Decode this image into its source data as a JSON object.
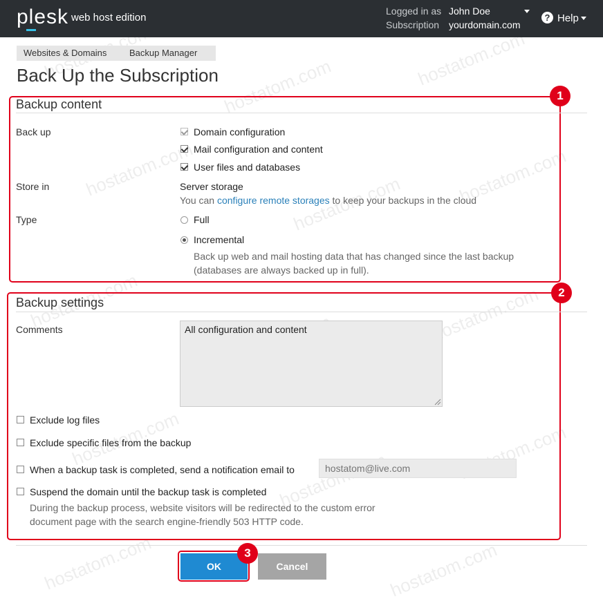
{
  "header": {
    "logo": "plesk",
    "edition": "web host edition",
    "logged_in_label": "Logged in as",
    "logged_in_user": "John Doe",
    "subscription_label": "Subscription",
    "subscription_value": "yourdomain.com",
    "help_label": "Help"
  },
  "breadcrumb": [
    "Websites & Domains",
    "Backup Manager"
  ],
  "page_title": "Back Up the Subscription",
  "backup_content": {
    "title": "Backup content",
    "badge": "1",
    "backup_label": "Back up",
    "options": [
      {
        "label": "Domain configuration",
        "checked": true,
        "disabled": true
      },
      {
        "label": "Mail configuration and content",
        "checked": true,
        "disabled": false
      },
      {
        "label": "User files and databases",
        "checked": true,
        "disabled": false
      }
    ],
    "store_label": "Store in",
    "store_value": "Server storage",
    "store_hint_pre": "You can",
    "store_hint_link": "configure remote storages",
    "store_hint_post": "to keep your backups in the cloud",
    "type_label": "Type",
    "type_full": "Full",
    "type_incremental": "Incremental",
    "type_selected": "Incremental",
    "incremental_desc_1": "Back up web and mail hosting data that has changed since the last backup",
    "incremental_desc_2": "(databases are always backed up in full)."
  },
  "backup_settings": {
    "title": "Backup settings",
    "badge": "2",
    "comments_label": "Comments",
    "comments_value": "All configuration and content",
    "exclude_logs": "Exclude log files",
    "exclude_specific": "Exclude specific files from the backup",
    "notify_label": "When a backup task is completed, send a notification email to",
    "notify_email_placeholder": "hostatom@live.com",
    "suspend_label": "Suspend the domain until the backup task is completed",
    "suspend_desc_1": "During the backup process, website visitors will be redirected to the custom error",
    "suspend_desc_2": "document page with the search engine-friendly 503 HTTP code."
  },
  "buttons": {
    "ok": "OK",
    "cancel": "Cancel",
    "badge": "3"
  },
  "watermark": "hostatom.com",
  "colors": {
    "header_bg": "#2b2f33",
    "accent_red": "#e0001a",
    "ok_button": "#1f8ad2",
    "cancel_button": "#a5a5a5",
    "link": "#2a80b9"
  }
}
